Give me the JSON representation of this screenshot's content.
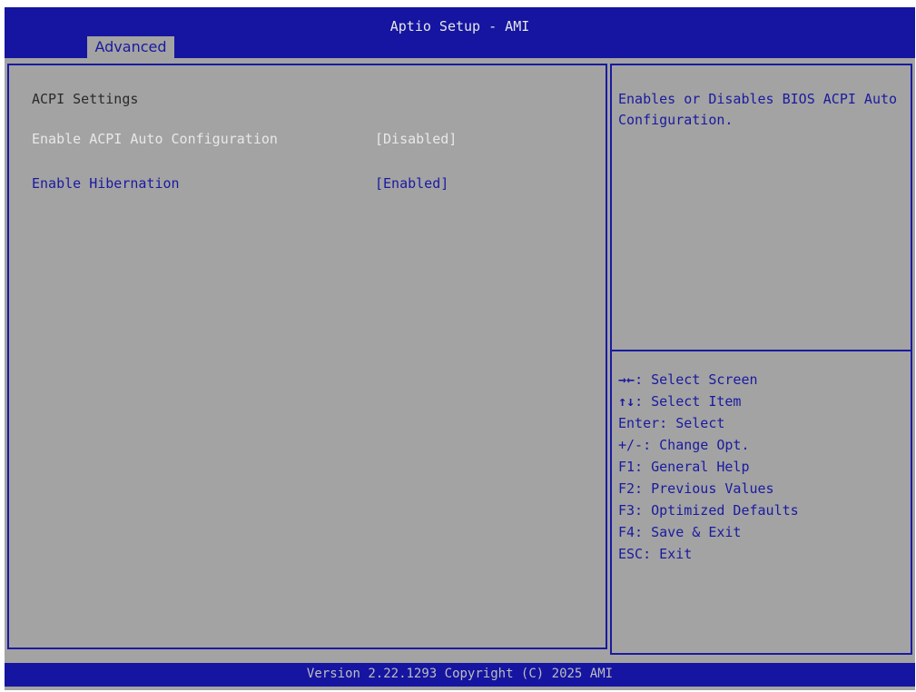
{
  "window": {
    "title": "Aptio Setup - AMI",
    "active_tab": "Advanced"
  },
  "main": {
    "section_title": "ACPI Settings",
    "settings": [
      {
        "label": "Enable ACPI Auto Configuration",
        "value": "[Disabled]"
      },
      {
        "label": "Enable Hibernation",
        "value": "[Enabled]"
      }
    ]
  },
  "help": {
    "text": "Enables or Disables BIOS ACPI Auto Configuration."
  },
  "keys": [
    {
      "key": "→←",
      "desc": ": Select Screen"
    },
    {
      "key": "↑↓",
      "desc": ": Select Item"
    },
    {
      "key": "",
      "desc": "Enter: Select"
    },
    {
      "key": "",
      "desc": "+/-: Change Opt."
    },
    {
      "key": "",
      "desc": "F1: General Help"
    },
    {
      "key": "",
      "desc": "F2: Previous Values"
    },
    {
      "key": "",
      "desc": "F3: Optimized Defaults"
    },
    {
      "key": "",
      "desc": "F4: Save & Exit"
    },
    {
      "key": "",
      "desc": "ESC: Exit"
    }
  ],
  "footer": {
    "text": "Version 2.22.1293 Copyright (C) 2025 AMI"
  },
  "colors": {
    "bar_blue": "#1515a1",
    "panel_grey": "#a3a3a3",
    "text_blue": "#1a1aa0",
    "text_white": "#e8e8e8"
  }
}
